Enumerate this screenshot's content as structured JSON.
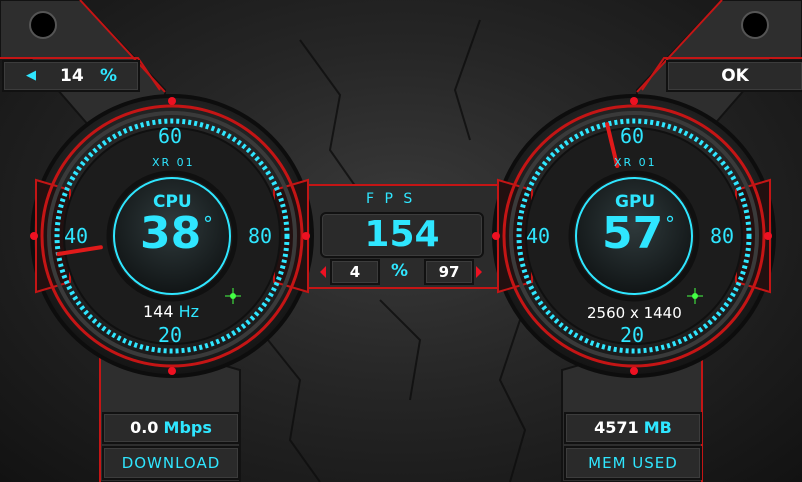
{
  "volume": {
    "value": "14",
    "unit": "%"
  },
  "ok_button": "OK",
  "cpu": {
    "name": "CPU",
    "temp": "38",
    "deg": "°",
    "model": "XR 01",
    "tick_top": "60",
    "tick_left": "40",
    "tick_right": "80",
    "tick_bottom": "20",
    "refresh_value": "144",
    "refresh_unit": "Hz",
    "needle_temp": 38
  },
  "gpu": {
    "name": "GPU",
    "temp": "57",
    "deg": "°",
    "model": "XR 01",
    "tick_top": "60",
    "tick_left": "40",
    "tick_right": "80",
    "tick_bottom": "20",
    "resolution": "2560 x 1440",
    "needle_temp": 57
  },
  "fps": {
    "label": "F P S",
    "value": "154",
    "min": "4",
    "unit": "%",
    "max": "97"
  },
  "download": {
    "value": "0.0",
    "unit": "Mbps",
    "label": "DOWNLOAD"
  },
  "memory": {
    "value": "4571",
    "unit": "MB",
    "label": "MEM USED"
  },
  "colors": {
    "accent": "#2fe6ff",
    "alert": "#c41515",
    "led": "#44ff44"
  }
}
